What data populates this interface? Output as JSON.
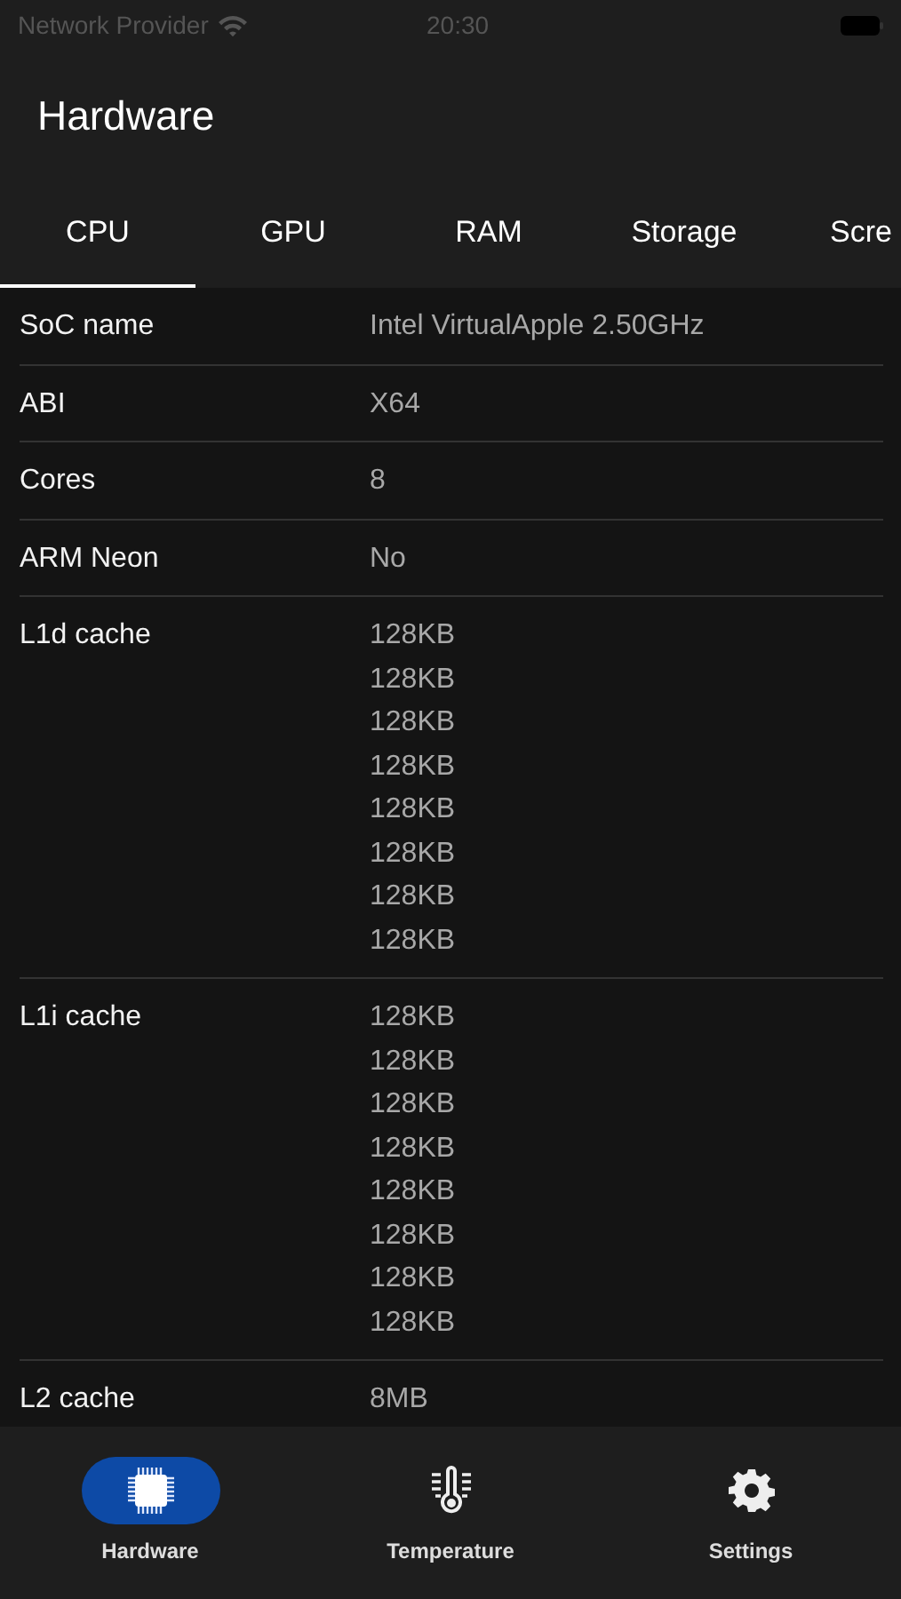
{
  "status_bar": {
    "carrier": "Network Provider",
    "time": "20:30"
  },
  "header": {
    "title": "Hardware"
  },
  "tabs": [
    {
      "label": "CPU",
      "selected": true
    },
    {
      "label": "GPU",
      "selected": false
    },
    {
      "label": "RAM",
      "selected": false
    },
    {
      "label": "Storage",
      "selected": false
    },
    {
      "label": "Scre",
      "selected": false
    }
  ],
  "rows": [
    {
      "label": "SoC name",
      "values": [
        "Intel VirtualApple 2.50GHz"
      ]
    },
    {
      "label": "ABI",
      "values": [
        "X64"
      ]
    },
    {
      "label": "Cores",
      "values": [
        "8"
      ]
    },
    {
      "label": "ARM Neon",
      "values": [
        "No"
      ]
    },
    {
      "label": "L1d cache",
      "values": [
        "128KB",
        "128KB",
        "128KB",
        "128KB",
        "128KB",
        "128KB",
        "128KB",
        "128KB"
      ]
    },
    {
      "label": "L1i cache",
      "values": [
        "128KB",
        "128KB",
        "128KB",
        "128KB",
        "128KB",
        "128KB",
        "128KB",
        "128KB"
      ]
    },
    {
      "label": "L2 cache",
      "values": [
        "8MB"
      ]
    }
  ],
  "bottom_nav": [
    {
      "label": "Hardware",
      "selected": true
    },
    {
      "label": "Temperature",
      "selected": false
    },
    {
      "label": "Settings",
      "selected": false
    }
  ]
}
